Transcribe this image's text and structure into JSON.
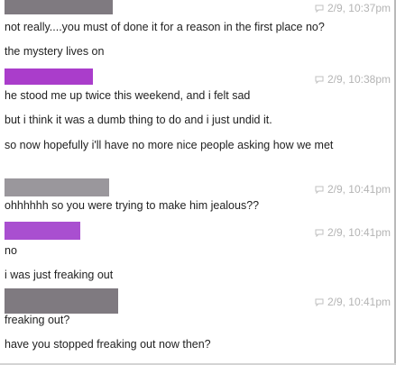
{
  "colors": {
    "redacted_gray": "#7f7a80",
    "redacted_light_gray": "#9a979c",
    "redacted_purple": "#aa3dcb",
    "redacted_purple_light": "#a94fd0",
    "timestamp": "#b4b4b4",
    "text": "#222222"
  },
  "messages": [
    {
      "timestamp": "2/9, 10:37pm",
      "icon": "chat-bubble-icon",
      "lines": [
        "not really....you must of done it for a reason in the first place no?",
        "the mystery lives on"
      ]
    },
    {
      "timestamp": "2/9, 10:38pm",
      "icon": "chat-bubble-icon",
      "lines": [
        "he stood me up twice this weekend, and i felt sad",
        "but i think it was a dumb thing to do and i just undid it.",
        "so now hopefully i'll have no more nice people asking how we met"
      ]
    },
    {
      "timestamp": "2/9, 10:41pm",
      "icon": "chat-bubble-icon",
      "lines": [
        "ohhhhhh so you were trying to make him jealous??"
      ]
    },
    {
      "timestamp": "2/9, 10:41pm",
      "icon": "chat-bubble-icon",
      "lines": [
        "no",
        "i was just freaking out"
      ]
    },
    {
      "timestamp": "2/9, 10:41pm",
      "icon": "chat-bubble-icon",
      "lines": [
        "freaking out?",
        "have you stopped freaking out now then?"
      ]
    }
  ]
}
